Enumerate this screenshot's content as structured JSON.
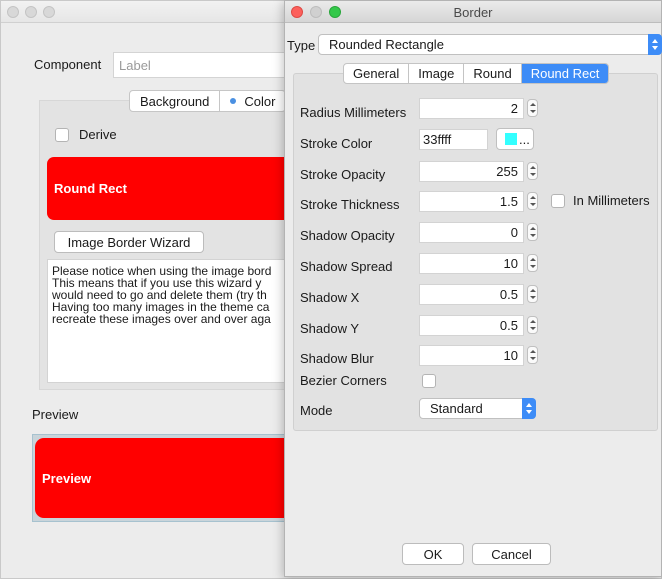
{
  "background_window": {
    "component_label": "Component",
    "component_placeholder": "Label",
    "tabs": [
      "Background",
      "Color"
    ],
    "derive_label": "Derive",
    "round_rect_text": "Round Rect",
    "wizard_button": "Image Border Wizard",
    "notice_lines": [
      "Please notice when using the image bord",
      "This means that if you use this wizard y",
      "would need to go and delete them (try th",
      "Having too many images in the theme ca",
      "recreate these images over and over aga"
    ],
    "preview_label": "Preview",
    "preview_text": "Preview"
  },
  "dialog": {
    "title": "Border",
    "type_label": "Type",
    "type_value": "Rounded Rectangle",
    "tabs": [
      "General",
      "Image",
      "Round",
      "Round Rect"
    ],
    "active_tab": "Round Rect",
    "fields": {
      "radius_mm": {
        "label": "Radius Millimeters",
        "value": "2"
      },
      "stroke_color": {
        "label": "Stroke Color",
        "value": "33ffff",
        "button": "..."
      },
      "stroke_opacity": {
        "label": "Stroke Opacity",
        "value": "255"
      },
      "stroke_thickness": {
        "label": "Stroke Thickness",
        "value": "1.5",
        "checkbox_label": "In Millimeters"
      },
      "shadow_opacity": {
        "label": "Shadow Opacity",
        "value": "0"
      },
      "shadow_spread": {
        "label": "Shadow Spread",
        "value": "10"
      },
      "shadow_x": {
        "label": "Shadow X",
        "value": "0.5"
      },
      "shadow_y": {
        "label": "Shadow Y",
        "value": "0.5"
      },
      "shadow_blur": {
        "label": "Shadow Blur",
        "value": "10"
      },
      "bezier_corners": {
        "label": "Bezier Corners",
        "checked": false
      },
      "mode": {
        "label": "Mode",
        "value": "Standard"
      }
    },
    "ok_button": "OK",
    "cancel_button": "Cancel"
  },
  "colors": {
    "accent": "#3d8cf7",
    "red": "#ff0000",
    "stroke_swatch": "#33ffff"
  }
}
